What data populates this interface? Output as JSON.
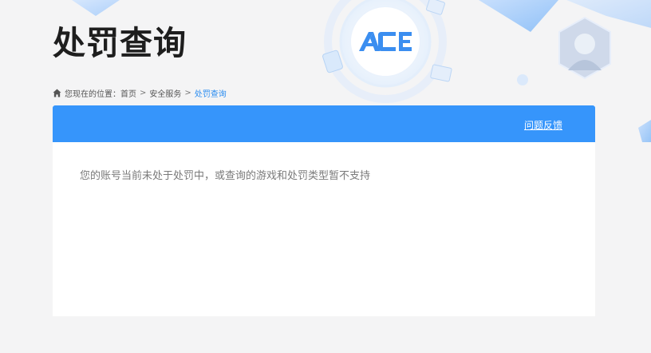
{
  "page": {
    "title": "处罚查询",
    "logo_text": "ACE"
  },
  "breadcrumb": {
    "prefix": "您现在的位置：",
    "items": [
      "首页",
      "安全服务",
      "处罚查询"
    ],
    "separator": ">"
  },
  "panel": {
    "feedback_label": "问题反馈",
    "status_message": "您的账号当前未处于处罚中，或查询的游戏和处罚类型暂不支持"
  },
  "icons": {
    "home": "home-icon",
    "logo": "ace-logo-icon"
  },
  "colors": {
    "accent": "#3695fb",
    "breadcrumb_current": "#2a8cf0",
    "background": "#f4f4f5",
    "title": "#1e1e1e"
  }
}
